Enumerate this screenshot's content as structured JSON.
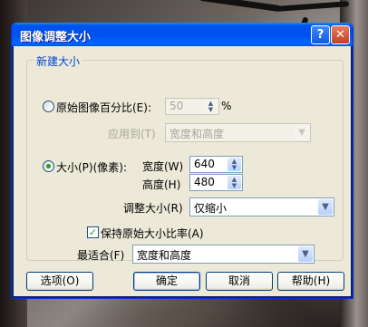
{
  "window": {
    "title": "图像调整大小",
    "help_glyph": "?",
    "close_glyph": "✕"
  },
  "group": {
    "label": "新建大小"
  },
  "percent": {
    "label": "原始图像百分比(E):",
    "value": "50",
    "unit": "%",
    "apply_to_label": "应用到(T)",
    "apply_to_value": "宽度和高度",
    "selected": false
  },
  "size": {
    "label": "大小(P)(像素):",
    "selected": true,
    "width_label": "宽度(W)",
    "width_value": "640",
    "height_label": "高度(H)",
    "height_value": "480",
    "resize_label": "调整大小(R)",
    "resize_value": "仅缩小"
  },
  "keep_ratio": {
    "label": "保持原始大小比率(A)",
    "checked": true
  },
  "best_fit": {
    "label": "最适合(F)",
    "value": "宽度和高度"
  },
  "buttons": {
    "options": "选项(O)",
    "ok": "确定",
    "cancel": "取消",
    "help": "帮助(H)"
  },
  "colors": {
    "titlebar": "#0053ee",
    "dialog": "#ece9d8",
    "accent_label": "#0046d5",
    "check": "#21a121"
  }
}
